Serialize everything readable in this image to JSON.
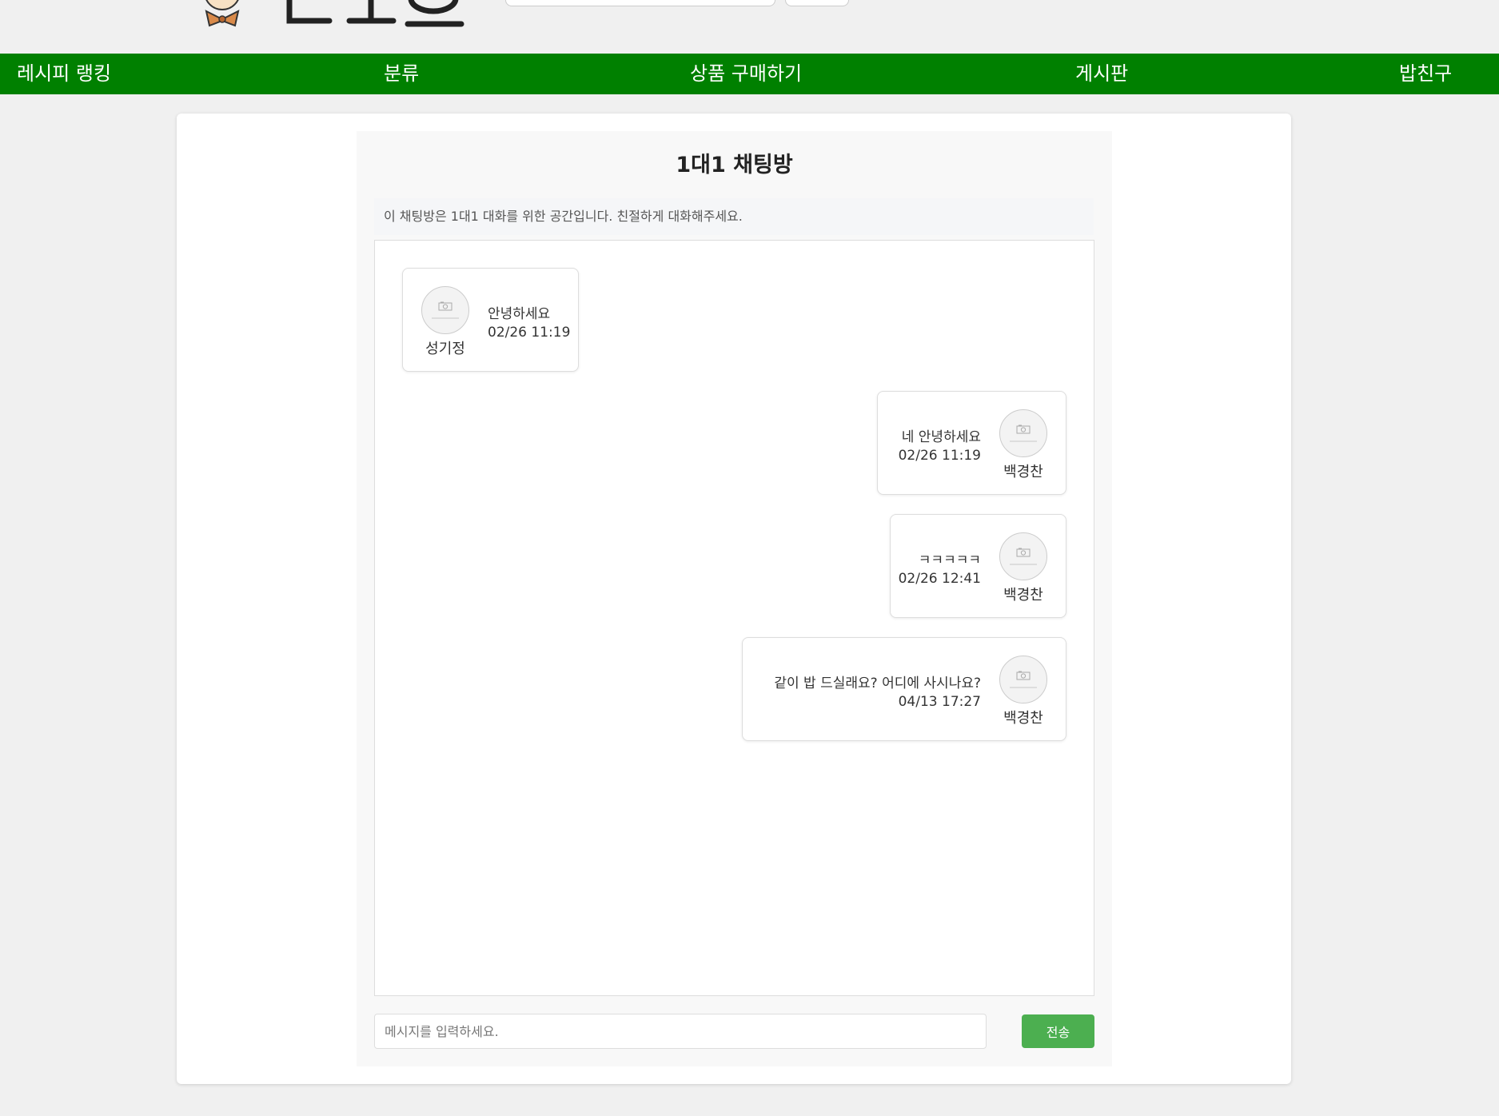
{
  "nav": {
    "items": [
      {
        "label": "레시피 랭킹"
      },
      {
        "label": "분류"
      },
      {
        "label": "상품 구매하기"
      },
      {
        "label": "게시판"
      },
      {
        "label": "밥친구"
      }
    ]
  },
  "chat": {
    "title": "1대1 채팅방",
    "notice": "이 채팅방은 1대1 대화를 위한 공간입니다. 친절하게 대화해주세요.",
    "messages": [
      {
        "user": "성기정",
        "text": "안녕하세요",
        "time": "02/26 11:19",
        "side": "left",
        "avatar_icon": "camera-placeholder-icon"
      },
      {
        "user": "백경찬",
        "text": "네 안녕하세요",
        "time": "02/26 11:19",
        "side": "right",
        "avatar_icon": "camera-placeholder-icon"
      },
      {
        "user": "백경찬",
        "text": "ㅋㅋㅋㅋㅋ",
        "time": "02/26 12:41",
        "side": "right",
        "avatar_icon": "camera-placeholder-icon"
      },
      {
        "user": "백경찬",
        "text": "같이 밥 드실래요? 어디에 사시나요?",
        "time": "04/13 17:27",
        "side": "right",
        "avatar_icon": "camera-placeholder-icon"
      }
    ],
    "input_placeholder": "메시지를 입력하세요.",
    "send_label": "전송"
  },
  "colors": {
    "nav_bg": "#008000",
    "send_button": "#4caf50",
    "page_bg": "#f0f0f0"
  }
}
